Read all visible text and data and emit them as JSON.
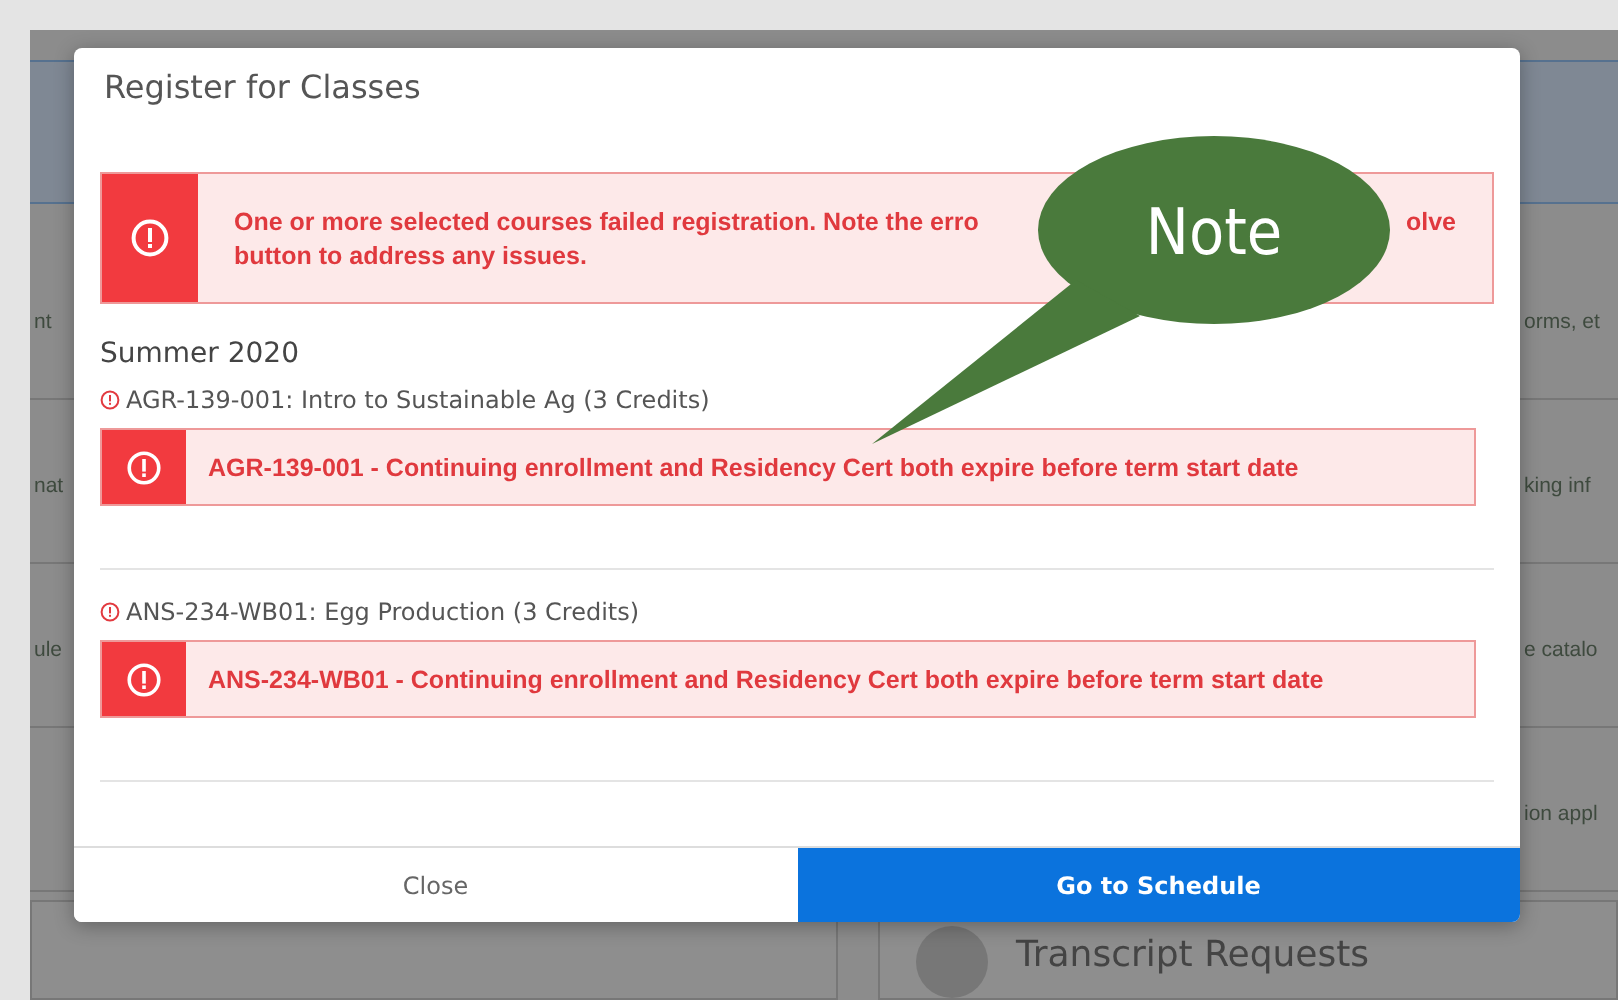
{
  "background": {
    "left_fragments": [
      "nt",
      "nat",
      "ule"
    ],
    "right_fragments": [
      "orms, et",
      "king inf",
      "e catalo",
      "ion appl"
    ],
    "bottom_card_title": "Transcript Requests"
  },
  "dialog": {
    "title": "Register for Classes",
    "banner": {
      "kind": "error",
      "line_1_start": "One or more selected courses failed registration. Note the erro",
      "line_1_end": "olve",
      "line_2": "button to address any issues."
    },
    "term": "Summer 2020",
    "courses": [
      {
        "title": "AGR-139-001: Intro to Sustainable Ag (3 Credits)",
        "failed": true,
        "message": "AGR-139-001 - Continuing enrollment and Residency Cert both expire before term start date"
      },
      {
        "title": "ANS-234-WB01: Egg Production (3 Credits)",
        "failed": true,
        "message": "ANS-234-WB01 - Continuing enrollment and Residency Cert both expire before term start date"
      }
    ],
    "buttons": [
      {
        "label": "Close",
        "kind": "secondary"
      },
      {
        "label": "Go to Schedule",
        "kind": "primary"
      }
    ]
  },
  "callout": {
    "text": "Note"
  }
}
